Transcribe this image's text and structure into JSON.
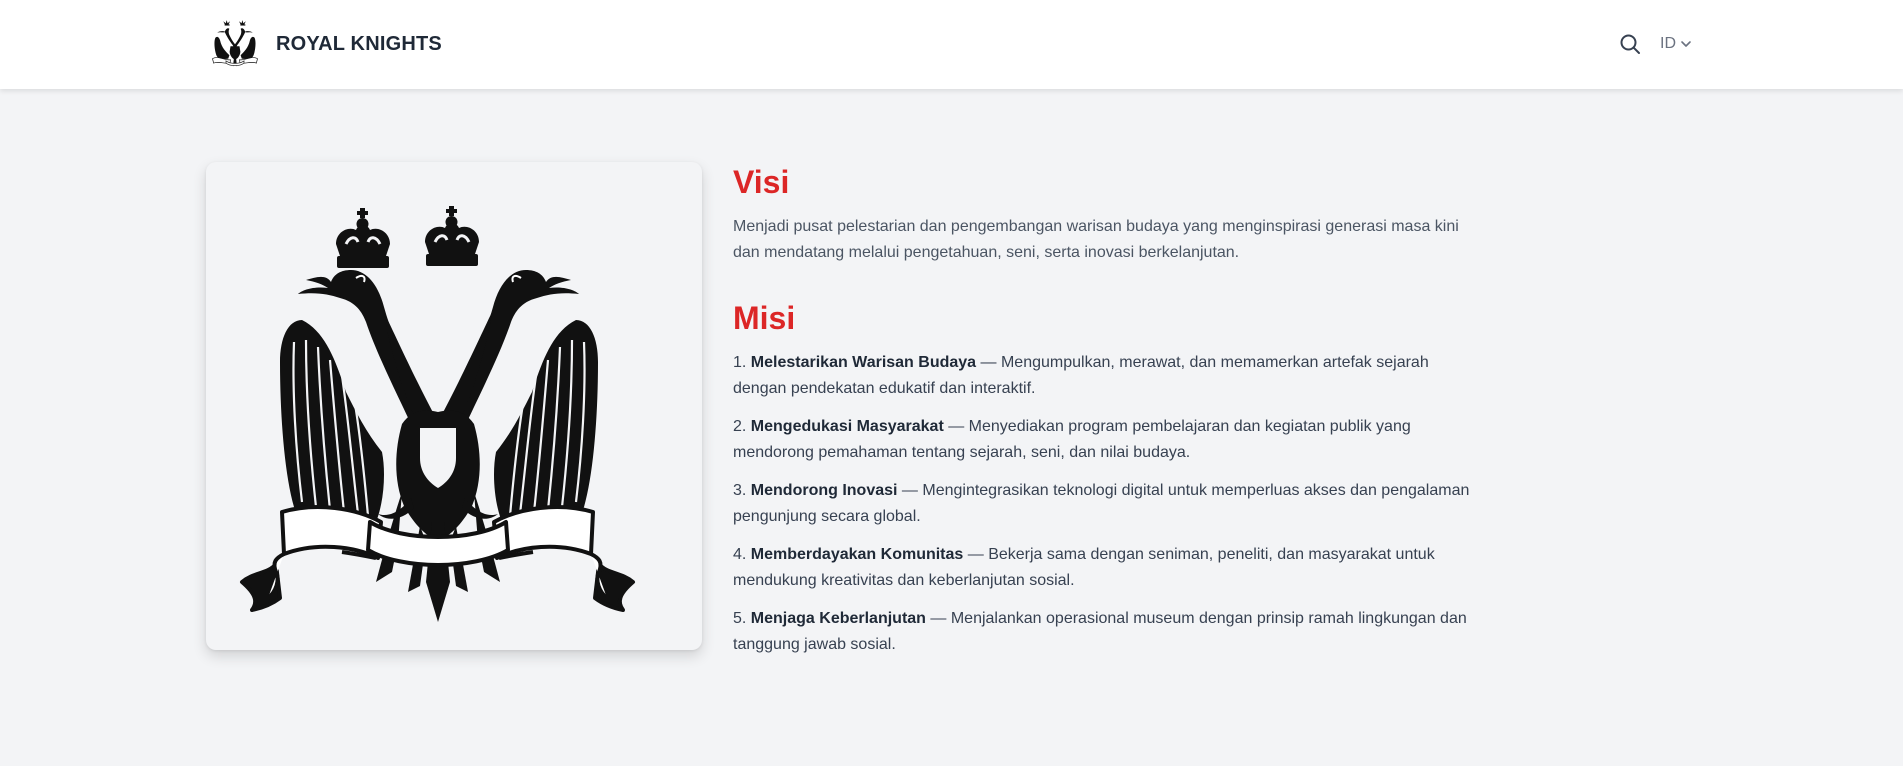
{
  "header": {
    "brand_name": "ROYAL KNIGHTS",
    "logo_icon": "double-headed-eagle-icon",
    "search_icon": "search-icon",
    "language": "ID"
  },
  "visi": {
    "title": "Visi",
    "text": "Menjadi pusat pelestarian dan pengembangan warisan budaya yang menginspirasi generasi masa kini dan mendatang melalui pengetahuan, seni, serta inovasi berkelanjutan."
  },
  "misi": {
    "title": "Misi",
    "items": [
      {
        "num": "1.",
        "title": "Melestarikan Warisan Budaya",
        "text": " — Mengumpulkan, merawat, dan memamerkan artefak sejarah dengan pendekatan edukatif dan interaktif."
      },
      {
        "num": "2.",
        "title": "Mengedukasi Masyarakat",
        "text": " — Menyediakan program pembelajaran dan kegiatan publik yang mendorong pemahaman tentang sejarah, seni, dan nilai budaya."
      },
      {
        "num": "3.",
        "title": "Mendorong Inovasi",
        "text": " — Mengintegrasikan teknologi digital untuk memperluas akses dan pengalaman pengunjung secara global."
      },
      {
        "num": "4.",
        "title": "Memberdayakan Komunitas",
        "text": " — Bekerja sama dengan seniman, peneliti, dan masyarakat untuk mendukung kreativitas dan keberlanjutan sosial."
      },
      {
        "num": "5.",
        "title": "Menjaga Keberlanjutan",
        "text": " — Menjalankan operasional museum dengan prinsip ramah lingkungan dan tanggung jawab sosial."
      }
    ]
  },
  "colors": {
    "accent": "#dc2626",
    "background": "#f3f4f6",
    "header_bg": "#ffffff",
    "text": "#374151"
  }
}
